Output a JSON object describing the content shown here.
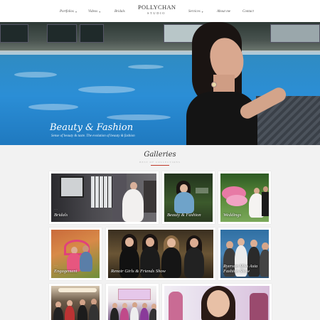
{
  "nav": {
    "items": [
      {
        "label": "Portfolios",
        "has_caret": true
      },
      {
        "label": "Videos",
        "has_caret": true
      },
      {
        "label": "Bridals",
        "has_caret": false
      },
      {
        "label": "Services",
        "has_caret": true
      },
      {
        "label": "About me",
        "has_caret": false
      },
      {
        "label": "Contact",
        "has_caret": false
      }
    ],
    "logo_main": "POLLYCHAN",
    "logo_sub": "STUDIO"
  },
  "hero": {
    "title": "Beauty & Fashion",
    "subtitle": "Sense of beauty & taste. The evolution of beauty & fashion"
  },
  "galleries": {
    "title": "Galleries",
    "subtitle": "BEST OF COLLECTIONS",
    "accent_color": "#c0392b",
    "tiles": [
      {
        "label": "Bridals"
      },
      {
        "label": "Beauty & Fashion"
      },
      {
        "label": "Weddings"
      },
      {
        "label": "Engagement"
      },
      {
        "label": "Renoir Girls & Friends Show"
      },
      {
        "label": "Ryerson Miss Asia\nFashion Show"
      },
      {
        "label": ""
      },
      {
        "label": ""
      },
      {
        "label": ""
      }
    ]
  }
}
